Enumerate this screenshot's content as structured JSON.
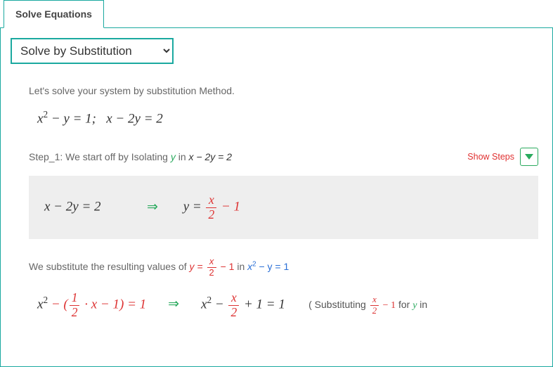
{
  "tab": {
    "label": "Solve Equations"
  },
  "method": {
    "selected": "Solve by Substitution",
    "options": [
      "Solve by Substitution"
    ]
  },
  "intro": "Let's solve your system by substitution Method.",
  "equations": {
    "eq1_lhs_pre": "x",
    "eq1_exp": "2",
    "eq1_rest": " − y = 1;",
    "eq2": "x − 2y = 2"
  },
  "step1": {
    "label_pre": "Step_1: We start off by Isolating ",
    "var": "y",
    "label_mid": " in ",
    "eq": "x − 2y = 2",
    "show_steps": "Show Steps"
  },
  "box": {
    "left": "x − 2y = 2",
    "right_pre": "y = ",
    "frac_num": "x",
    "frac_den": "2",
    "right_post": " − 1"
  },
  "subst": {
    "text_pre": "We substitute the resulting values of ",
    "y_expr_pre": "y = ",
    "y_frac_num": "x",
    "y_frac_den": "2",
    "y_expr_post": " − 1",
    "text_mid": " in ",
    "target_x": "x",
    "target_exp": "2",
    "target_rest": " − y = 1"
  },
  "result": {
    "lhs_x": "x",
    "lhs_exp": "2",
    "lhs_mid": " − (",
    "half_num": "1",
    "half_den": "2",
    "dot_x": " · x − 1) = 1",
    "arrow": "⇒",
    "rhs_x": "x",
    "rhs_exp": "2",
    "rhs_mid": " − ",
    "frac_num": "x",
    "frac_den": "2",
    "rhs_post": " + 1 = 1",
    "note_pre": "( Substituting  ",
    "note_frac_num": "x",
    "note_frac_den": "2",
    "note_mid": " − 1",
    "note_for": "  for  ",
    "note_y": "y",
    "note_in": "  in"
  }
}
